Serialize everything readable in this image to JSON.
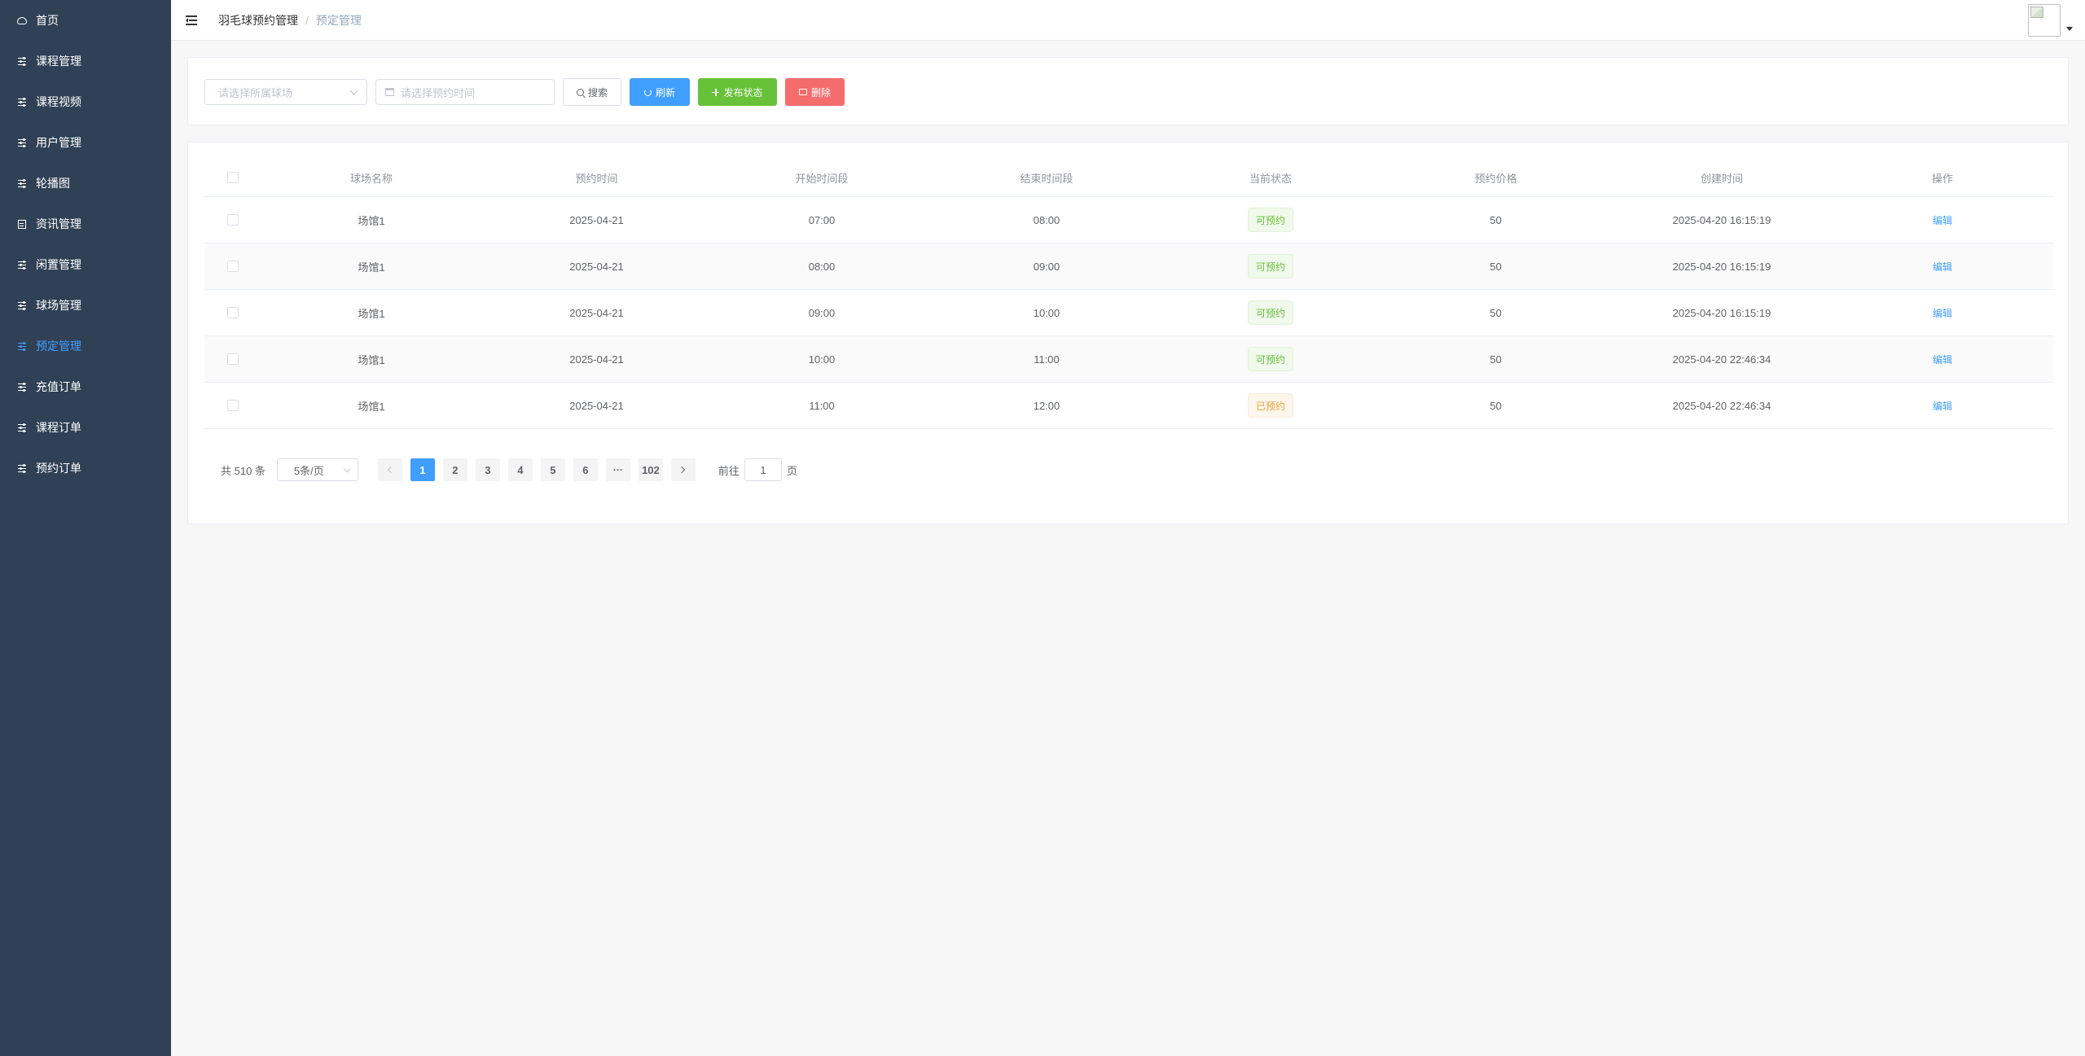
{
  "sidebar": {
    "items": [
      {
        "label": "首页",
        "icon": "dashboard-icon",
        "active": false
      },
      {
        "label": "课程管理",
        "icon": "sliders-icon",
        "active": false
      },
      {
        "label": "课程视频",
        "icon": "sliders-icon",
        "active": false
      },
      {
        "label": "用户管理",
        "icon": "sliders-icon",
        "active": false
      },
      {
        "label": "轮播图",
        "icon": "sliders-icon",
        "active": false
      },
      {
        "label": "资讯管理",
        "icon": "document-icon",
        "active": false
      },
      {
        "label": "闲置管理",
        "icon": "sliders-icon",
        "active": false
      },
      {
        "label": "球场管理",
        "icon": "sliders-icon",
        "active": false
      },
      {
        "label": "预定管理",
        "icon": "sliders-icon",
        "active": true
      },
      {
        "label": "充值订单",
        "icon": "sliders-icon",
        "active": false
      },
      {
        "label": "课程订单",
        "icon": "sliders-icon",
        "active": false
      },
      {
        "label": "预约订单",
        "icon": "sliders-icon",
        "active": false
      }
    ]
  },
  "header": {
    "breadcrumb": [
      "羽毛球预约管理",
      "预定管理"
    ],
    "separator": "/"
  },
  "toolbar": {
    "venue_placeholder": "请选择所属球场",
    "date_placeholder": "请选择预约时间",
    "search_label": "搜索",
    "refresh_label": "刷新",
    "publish_label": "发布状态",
    "delete_label": "删除"
  },
  "table": {
    "columns": [
      "球场名称",
      "预约时间",
      "开始时间段",
      "结束时间段",
      "当前状态",
      "预约价格",
      "创建时间",
      "操作"
    ],
    "rows": [
      {
        "name": "场馆1",
        "date": "2025-04-21",
        "start": "07:00",
        "end": "08:00",
        "status": "可预约",
        "status_type": "available",
        "price": "50",
        "created": "2025-04-20 16:15:19",
        "action": "编辑"
      },
      {
        "name": "场馆1",
        "date": "2025-04-21",
        "start": "08:00",
        "end": "09:00",
        "status": "可预约",
        "status_type": "available",
        "price": "50",
        "created": "2025-04-20 16:15:19",
        "action": "编辑"
      },
      {
        "name": "场馆1",
        "date": "2025-04-21",
        "start": "09:00",
        "end": "10:00",
        "status": "可预约",
        "status_type": "available",
        "price": "50",
        "created": "2025-04-20 16:15:19",
        "action": "编辑"
      },
      {
        "name": "场馆1",
        "date": "2025-04-21",
        "start": "10:00",
        "end": "11:00",
        "status": "可预约",
        "status_type": "available",
        "price": "50",
        "created": "2025-04-20 22:46:34",
        "action": "编辑"
      },
      {
        "name": "场馆1",
        "date": "2025-04-21",
        "start": "11:00",
        "end": "12:00",
        "status": "已预约",
        "status_type": "booked",
        "price": "50",
        "created": "2025-04-20 22:46:34",
        "action": "编辑"
      }
    ]
  },
  "pagination": {
    "total_text": "共 510 条",
    "page_size": "5条/页",
    "pages": [
      "1",
      "2",
      "3",
      "4",
      "5",
      "6",
      "···",
      "102"
    ],
    "current_page": "1",
    "goto_prefix": "前往",
    "goto_value": "1",
    "goto_suffix": "页"
  },
  "colors": {
    "sidebar_bg": "#304156",
    "accent": "#409eff",
    "success": "#67c23a",
    "danger": "#f56c6c",
    "warning": "#e6a23c"
  }
}
